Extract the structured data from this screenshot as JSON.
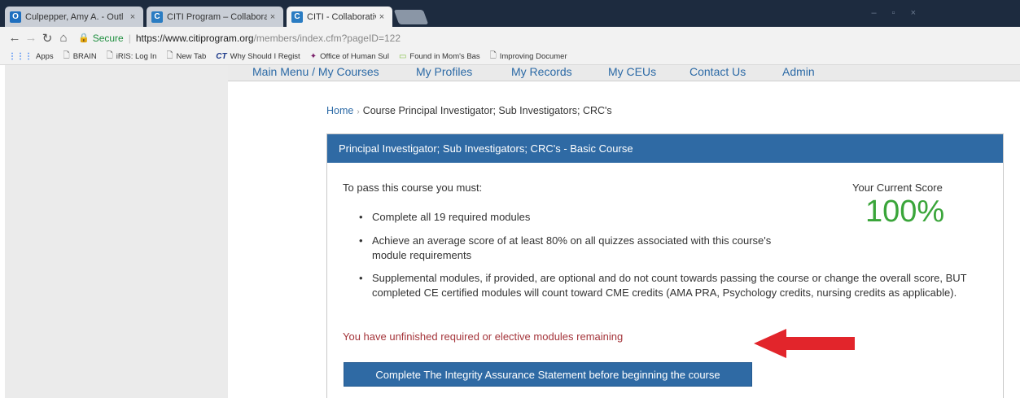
{
  "browser": {
    "tabs": [
      {
        "title": "Culpepper, Amy A. - Outl",
        "icon": "outlook-icon",
        "color": "#1f6fbf",
        "glyph": "O"
      },
      {
        "title": "CITI Program – Collabora",
        "icon": "citi-icon",
        "color": "#2a7cc2",
        "glyph": "C"
      },
      {
        "title": "CITI - Collaborative Instit",
        "icon": "citi-icon",
        "color": "#2a7cc2",
        "glyph": "C"
      }
    ],
    "close_glyph": "×",
    "address": {
      "secure_label": "Secure",
      "url_host": "https://www.citiprogram.org",
      "url_path": "/members/index.cfm?pageID=122"
    },
    "bookmarks": [
      {
        "label": "Apps",
        "icon": "apps-icon"
      },
      {
        "label": "BRAIN",
        "icon": "page-icon"
      },
      {
        "label": "iRIS: Log In",
        "icon": "page-icon"
      },
      {
        "label": "New Tab",
        "icon": "page-icon"
      },
      {
        "label": "Why Should I Regist",
        "icon": "ct-icon"
      },
      {
        "label": "Office of Human Sul",
        "icon": "hs-icon"
      },
      {
        "label": "Found in Mom's Bas",
        "icon": "found-icon"
      },
      {
        "label": "Improving Documer",
        "icon": "page-icon"
      }
    ]
  },
  "nav": {
    "items": [
      "Main Menu / My Courses",
      "My Profiles",
      "My Records",
      "My CEUs",
      "Contact Us",
      "Admin"
    ]
  },
  "breadcrumb": {
    "home": "Home",
    "separator": "›",
    "current": "Course Principal Investigator; Sub Investigators; CRC's"
  },
  "course": {
    "title": "Principal Investigator; Sub Investigators; CRC's - Basic Course",
    "requirements_title": "To pass this course you must:",
    "requirements": [
      "Complete all 19 required modules",
      "Achieve an average score of at least 80% on all quizzes associated with this course's module requirements",
      "Supplemental modules, if provided, are optional and do not count towards passing the course or change the overall score, BUT completed CE certified modules will count toward CME credits (AMA PRA, Psychology credits, nursing credits as applicable)."
    ],
    "score_label": "Your Current Score",
    "score_value": "100%",
    "warning": "You have unfinished required or elective modules remaining",
    "cta": "Complete The Integrity Assurance Statement before beginning the course"
  },
  "colors": {
    "header_blue": "#2f6aa4",
    "score_green": "#3aa53a",
    "warning_red": "#a4343a",
    "annotation_arrow": "#e2252b"
  }
}
